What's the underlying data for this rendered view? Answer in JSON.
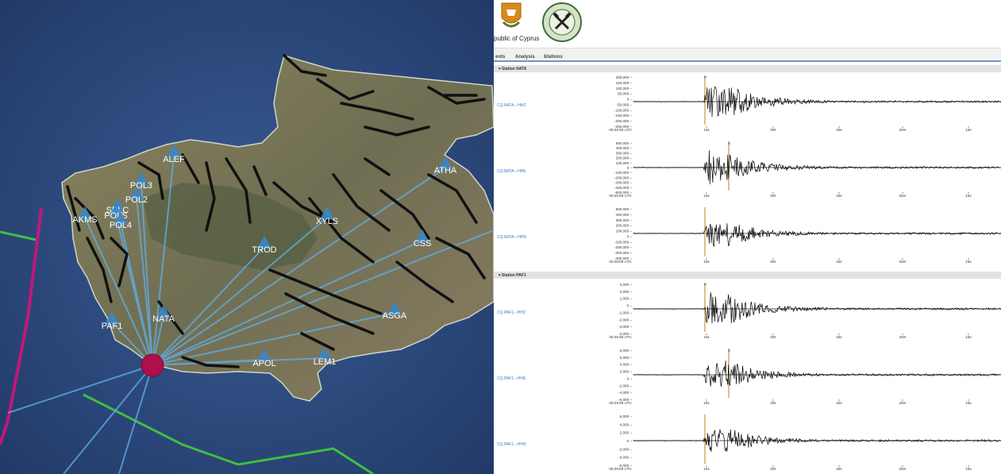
{
  "map": {
    "stations": [
      {
        "code": "ALEF"
      },
      {
        "code": "POL3"
      },
      {
        "code": "POL2"
      },
      {
        "code": "SPLC"
      },
      {
        "code": "AKMS"
      },
      {
        "code": "POLS"
      },
      {
        "code": "POL4"
      },
      {
        "code": "ATHA"
      },
      {
        "code": "XYLS"
      },
      {
        "code": "TROD"
      },
      {
        "code": "CSS"
      },
      {
        "code": "ASGA"
      },
      {
        "code": "PAF1"
      },
      {
        "code": "NATA"
      },
      {
        "code": "APOL"
      },
      {
        "code": "LEM1"
      }
    ],
    "colors": {
      "sea": "#263f6e",
      "land": "#7a7a5a",
      "ray": "#5fb0ea",
      "epicenter": "#b0104a",
      "station": "#3a86c8",
      "fault": "#111111",
      "boundary_green": "#3fbf3f",
      "boundary_pink": "#c0187a"
    }
  },
  "panel": {
    "header": {
      "republic": "public of Cyprus",
      "coat_icon": "coat-of-arms-icon",
      "seal_icon": "geological-survey-seal-icon"
    },
    "menu": {
      "events": "ents",
      "analysis": "Analysis",
      "stations": "Stations",
      "caret": "▾"
    },
    "sections": [
      {
        "title": "▾  Station NATA",
        "channels": [
          {
            "label": "CQ.NATA.--HHZ",
            "y_ticks": [
              "200,000 –",
              "150,000 –",
              "100,000 –",
              "50,000 –",
              "0 –",
              "-50,000 –",
              "-100,000 –",
              "-150,000 –",
              "-200,000 –",
              "-250,000 –"
            ],
            "pick": "P",
            "amplitude": 0.9
          },
          {
            "label": "CQ.NATA.--HHE",
            "y_ticks": [
              "500,000 –",
              "400,000 –",
              "300,000 –",
              "200,000 –",
              "100,000 –",
              "0 –",
              "-100,000 –",
              "-200,000 –",
              "-300,000 –",
              "-400,000 –",
              "-500,000 –"
            ],
            "pick": "S",
            "amplitude": 0.8
          },
          {
            "label": "CQ.NATA.--HHN",
            "y_ticks": [
              "500,000 –",
              "400,000 –",
              "300,000 –",
              "200,000 –",
              "100,000 –",
              "0 –",
              "-100,000 –",
              "-200,000 –",
              "-300,000 –",
              "-400,000 –"
            ],
            "pick": "",
            "amplitude": 0.7
          }
        ]
      },
      {
        "title": "▾  Station PAF1",
        "channels": [
          {
            "label": "CQ.PAF1.--HHZ",
            "y_ticks": [
              "3,000 –",
              "2,000 –",
              "1,000 –",
              "0 –",
              "-1,000 –",
              "-2,000 –",
              "-3,000 –",
              "-4,000 –"
            ],
            "pick": "P",
            "amplitude": 0.85
          },
          {
            "label": "CQ.PAF1.--HHE",
            "y_ticks": [
              "8,000 –",
              "6,000 –",
              "4,000 –",
              "2,000 –",
              "0 –",
              "-2,000 –",
              "-4,000 –",
              "-6,000 –"
            ],
            "pick": "S",
            "amplitude": 0.75
          },
          {
            "label": "CQ.PAF1.--HHN",
            "y_ticks": [
              "6,000 –",
              "4,000 –",
              "2,000 –",
              "0 –",
              "-2,000 –",
              "-4,000 –",
              "-6,000 –"
            ],
            "pick": "",
            "amplitude": 0.7
          }
        ]
      }
    ],
    "time_axis": {
      "start": "06:26:59 UTC",
      "ticks": [
        "15s",
        "30s",
        "45s",
        "28m",
        "15s"
      ]
    }
  }
}
